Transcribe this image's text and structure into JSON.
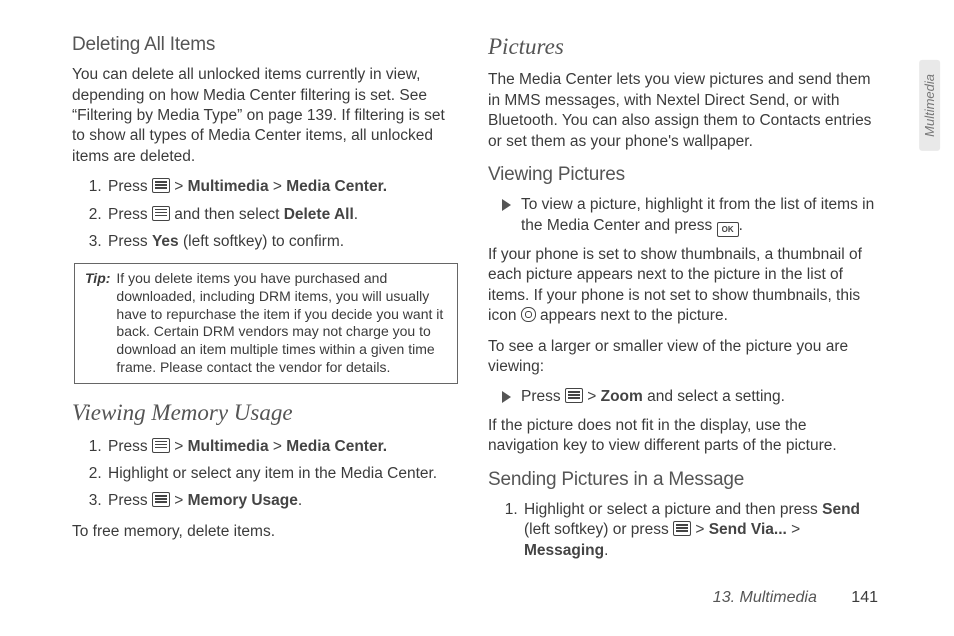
{
  "side_tab": "Multimedia",
  "footer": {
    "chapter": "13. Multimedia",
    "page": "141"
  },
  "icons": {
    "ok_label": "OK"
  },
  "gt": ">",
  "left": {
    "h_del": "Deleting All Items",
    "p_del": "You can delete all unlocked items currently in view, depending on how Media Center filtering is set. See “Filtering by Media Type” on page 139. If filtering is set to show all types of Media Center items, all unlocked items are deleted.",
    "del_steps": {
      "s1a": "Press ",
      "s1_m1": "Multimedia",
      "s1_m2": "Media Center.",
      "s2a": "Press ",
      "s2b": " and then select ",
      "s2c": "Delete All",
      "s2d": ".",
      "s3a": "Press ",
      "s3b": "Yes",
      "s3c": " (left softkey) to confirm."
    },
    "tip_label": "Tip:",
    "tip_body": "If you delete items you have purchased and downloaded, including DRM items, you will usually have to repurchase the item if you decide you want it back. Certain DRM vendors may not charge you to download an item multiple times within a given time frame. Please contact the vendor for details.",
    "h_mem": "Viewing Memory Usage",
    "mem_steps": {
      "s1a": "Press ",
      "s1_m1": "Multimedia",
      "s1_m2": "Media Center.",
      "s2": "Highlight or select any item in the Media Center.",
      "s3a": "Press ",
      "s3_m1": "Memory Usage",
      "s3b": "."
    },
    "p_free": "To free memory, delete items."
  },
  "right": {
    "h_pic": "Pictures",
    "p_pic": "The Media Center lets you view pictures and send them in MMS messages, with Nextel Direct Send, or with Bluetooth. You can also assign them to Contacts entries or set them as your phone's wallpaper.",
    "h_view": "Viewing Pictures",
    "view_item1_a": "To view a picture, highlight it from the list of items in the Media Center and press ",
    "view_item1_b": ".",
    "p_thumb_a": "If your phone is set to show thumbnails, a thumbnail of each picture appears next to the picture in the list of items. If your phone is not set to show thumbnails, this icon ",
    "p_thumb_b": " appears next to the picture.",
    "p_zoom_intro": "To see a larger or smaller view of the picture you are viewing:",
    "zoom_a": "Press ",
    "zoom_m1": "Zoom",
    "zoom_b": " and select a setting.",
    "p_nofit": "If the picture does not fit in the display, use the navigation key to view different parts of the picture.",
    "h_send": "Sending Pictures in a Message",
    "send_steps": {
      "s1a": "Highlight or select a picture and then press ",
      "s1b": "Send",
      "s1c": " (left softkey) or press ",
      "s1_m1": "Send Via...",
      "s1_m2": "Messaging",
      "s1d": "."
    }
  }
}
